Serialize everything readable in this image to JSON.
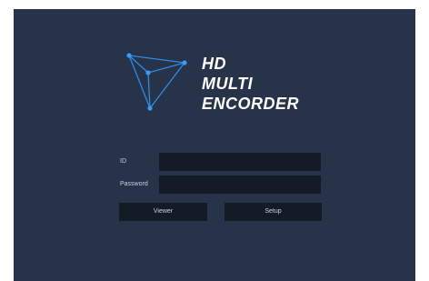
{
  "brand": {
    "line1": "HD",
    "line2": "MULTI",
    "line3": "ENCORDER",
    "logo_icon": "triangle-network-icon"
  },
  "login": {
    "id_label": "ID",
    "id_value": "",
    "password_label": "Password",
    "password_value": ""
  },
  "buttons": {
    "viewer": "Viewer",
    "setup": "Setup"
  },
  "colors": {
    "background": "#263349",
    "input": "#131b27",
    "logo_accent": "#2e8be6"
  }
}
